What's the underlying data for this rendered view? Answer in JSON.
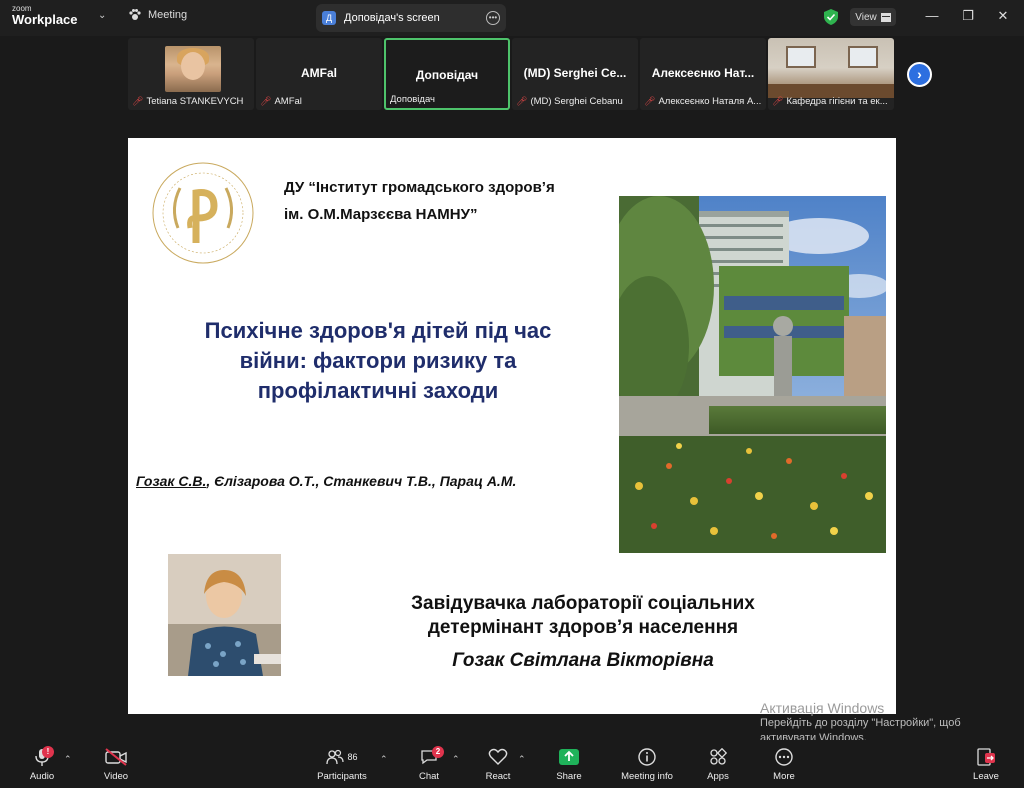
{
  "titlebar": {
    "logo_line1": "zoom",
    "logo_line2": "Workplace",
    "meeting_label": "Meeting",
    "share_badge": "Д",
    "share_title": "Доповідач's screen",
    "view_label": "View"
  },
  "participants": [
    {
      "name_tag": "Tetiana STANKEVYCH",
      "big_name": "",
      "muted": true,
      "type": "video-person"
    },
    {
      "name_tag": "AMFal",
      "big_name": "AMFal",
      "muted": true,
      "type": "name"
    },
    {
      "name_tag": "Доповідач",
      "big_name": "Доповідач",
      "muted": false,
      "type": "name-active"
    },
    {
      "name_tag": "(MD) Serghei Cebanu",
      "big_name": "(MD)  Serghei Ce...",
      "muted": true,
      "type": "name"
    },
    {
      "name_tag": "Алексеєнко Наталя А...",
      "big_name": "Алексеєнко  Нат...",
      "muted": true,
      "type": "name"
    },
    {
      "name_tag": "Кафедра гігієни та ек...",
      "big_name": "",
      "muted": true,
      "type": "video-room"
    }
  ],
  "slide": {
    "institute_line1": "ДУ  “Інститут громадського здоров’я",
    "institute_line2": "ім. О.М.Марзєєва НАМНУ”",
    "title_line1": "Психічне здоров'я дітей під час",
    "title_line2": "війни: фактори ризику та",
    "title_line3": "профілактичні заходи",
    "author_main": "Гозак С.В.",
    "authors_rest": ", Єлізарова О.Т., Станкевич Т.В., Парац А.М.",
    "position_line1": "Завідувачка лабораторії соціальних",
    "position_line2": "детермінант здоров’я населення",
    "presenter_name": "Гозак Світлана Вікторівна"
  },
  "watermark": {
    "heading": "Активація Windows",
    "line1": "Перейдіть до розділу \"Настройки\", щоб",
    "line2": "активувати Windows."
  },
  "toolbar": {
    "audio": "Audio",
    "audio_badge": "!",
    "video": "Video",
    "participants": "Participants",
    "participants_count": "86",
    "chat": "Chat",
    "chat_badge": "2",
    "react": "React",
    "share": "Share",
    "meeting_info": "Meeting info",
    "apps": "Apps",
    "more": "More",
    "leave": "Leave"
  },
  "colors": {
    "slide_title": "#1f2d6b",
    "active_border": "#4ec36b",
    "share_green": "#1fb25a",
    "leave_red": "#e0344d",
    "next_blue": "#2d6fe0"
  }
}
